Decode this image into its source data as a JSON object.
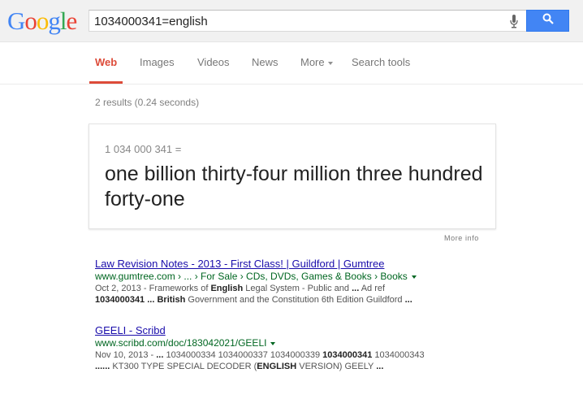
{
  "logo": {
    "letters": [
      "G",
      "o",
      "o",
      "g",
      "l",
      "e"
    ],
    "colors": [
      "#4285f4",
      "#ea4335",
      "#fbbc05",
      "#4285f4",
      "#34a853",
      "#ea4335"
    ]
  },
  "search": {
    "query": "1034000341=english"
  },
  "tabs": {
    "web": "Web",
    "images": "Images",
    "videos": "Videos",
    "news": "News",
    "more": "More",
    "tools": "Search tools"
  },
  "stats": "2 results (0.24 seconds)",
  "answer": {
    "equation": "1 034 000 341 =",
    "words": "one billion thirty-four million three hundred forty-one",
    "more_info": "More info"
  },
  "results": [
    {
      "title": "Law Revision Notes - 2013 - First Class! | Guildford | Gumtree",
      "url": "www.gumtree.com › ... › For Sale › CDs, DVDs, Games & Books › Books",
      "snippet_line1": [
        {
          "t": "Oct 2, 2013 - Frameworks of ",
          "b": false
        },
        {
          "t": "English",
          "b": true
        },
        {
          "t": " Legal System - Public and ",
          "b": false
        },
        {
          "t": "...",
          "b": true
        },
        {
          "t": " Ad ref",
          "b": false
        }
      ],
      "snippet_line2": [
        {
          "t": "1034000341",
          "b": true
        },
        {
          "t": " ",
          "b": false
        },
        {
          "t": "...",
          "b": true
        },
        {
          "t": " ",
          "b": false
        },
        {
          "t": "British",
          "b": true
        },
        {
          "t": " Government and the Constitution 6th Edition Guildford  ",
          "b": false
        },
        {
          "t": "...",
          "b": true
        }
      ]
    },
    {
      "title": "GEELI - Scribd",
      "url": "www.scribd.com/doc/183042021/GEELI",
      "snippet_line1": [
        {
          "t": "Nov 10, 2013 - ",
          "b": false
        },
        {
          "t": "...",
          "b": true
        },
        {
          "t": " 1034000334 1034000337 1034000339 ",
          "b": false
        },
        {
          "t": "1034000341",
          "b": true
        },
        {
          "t": " 1034000343",
          "b": false
        }
      ],
      "snippet_line2": [
        {
          "t": "......",
          "b": true
        },
        {
          "t": " KT300 TYPE SPECIAL DECODER (",
          "b": false
        },
        {
          "t": "ENGLISH",
          "b": true
        },
        {
          "t": " VERSION) GEELY ",
          "b": false
        },
        {
          "t": "...",
          "b": true
        }
      ]
    }
  ]
}
